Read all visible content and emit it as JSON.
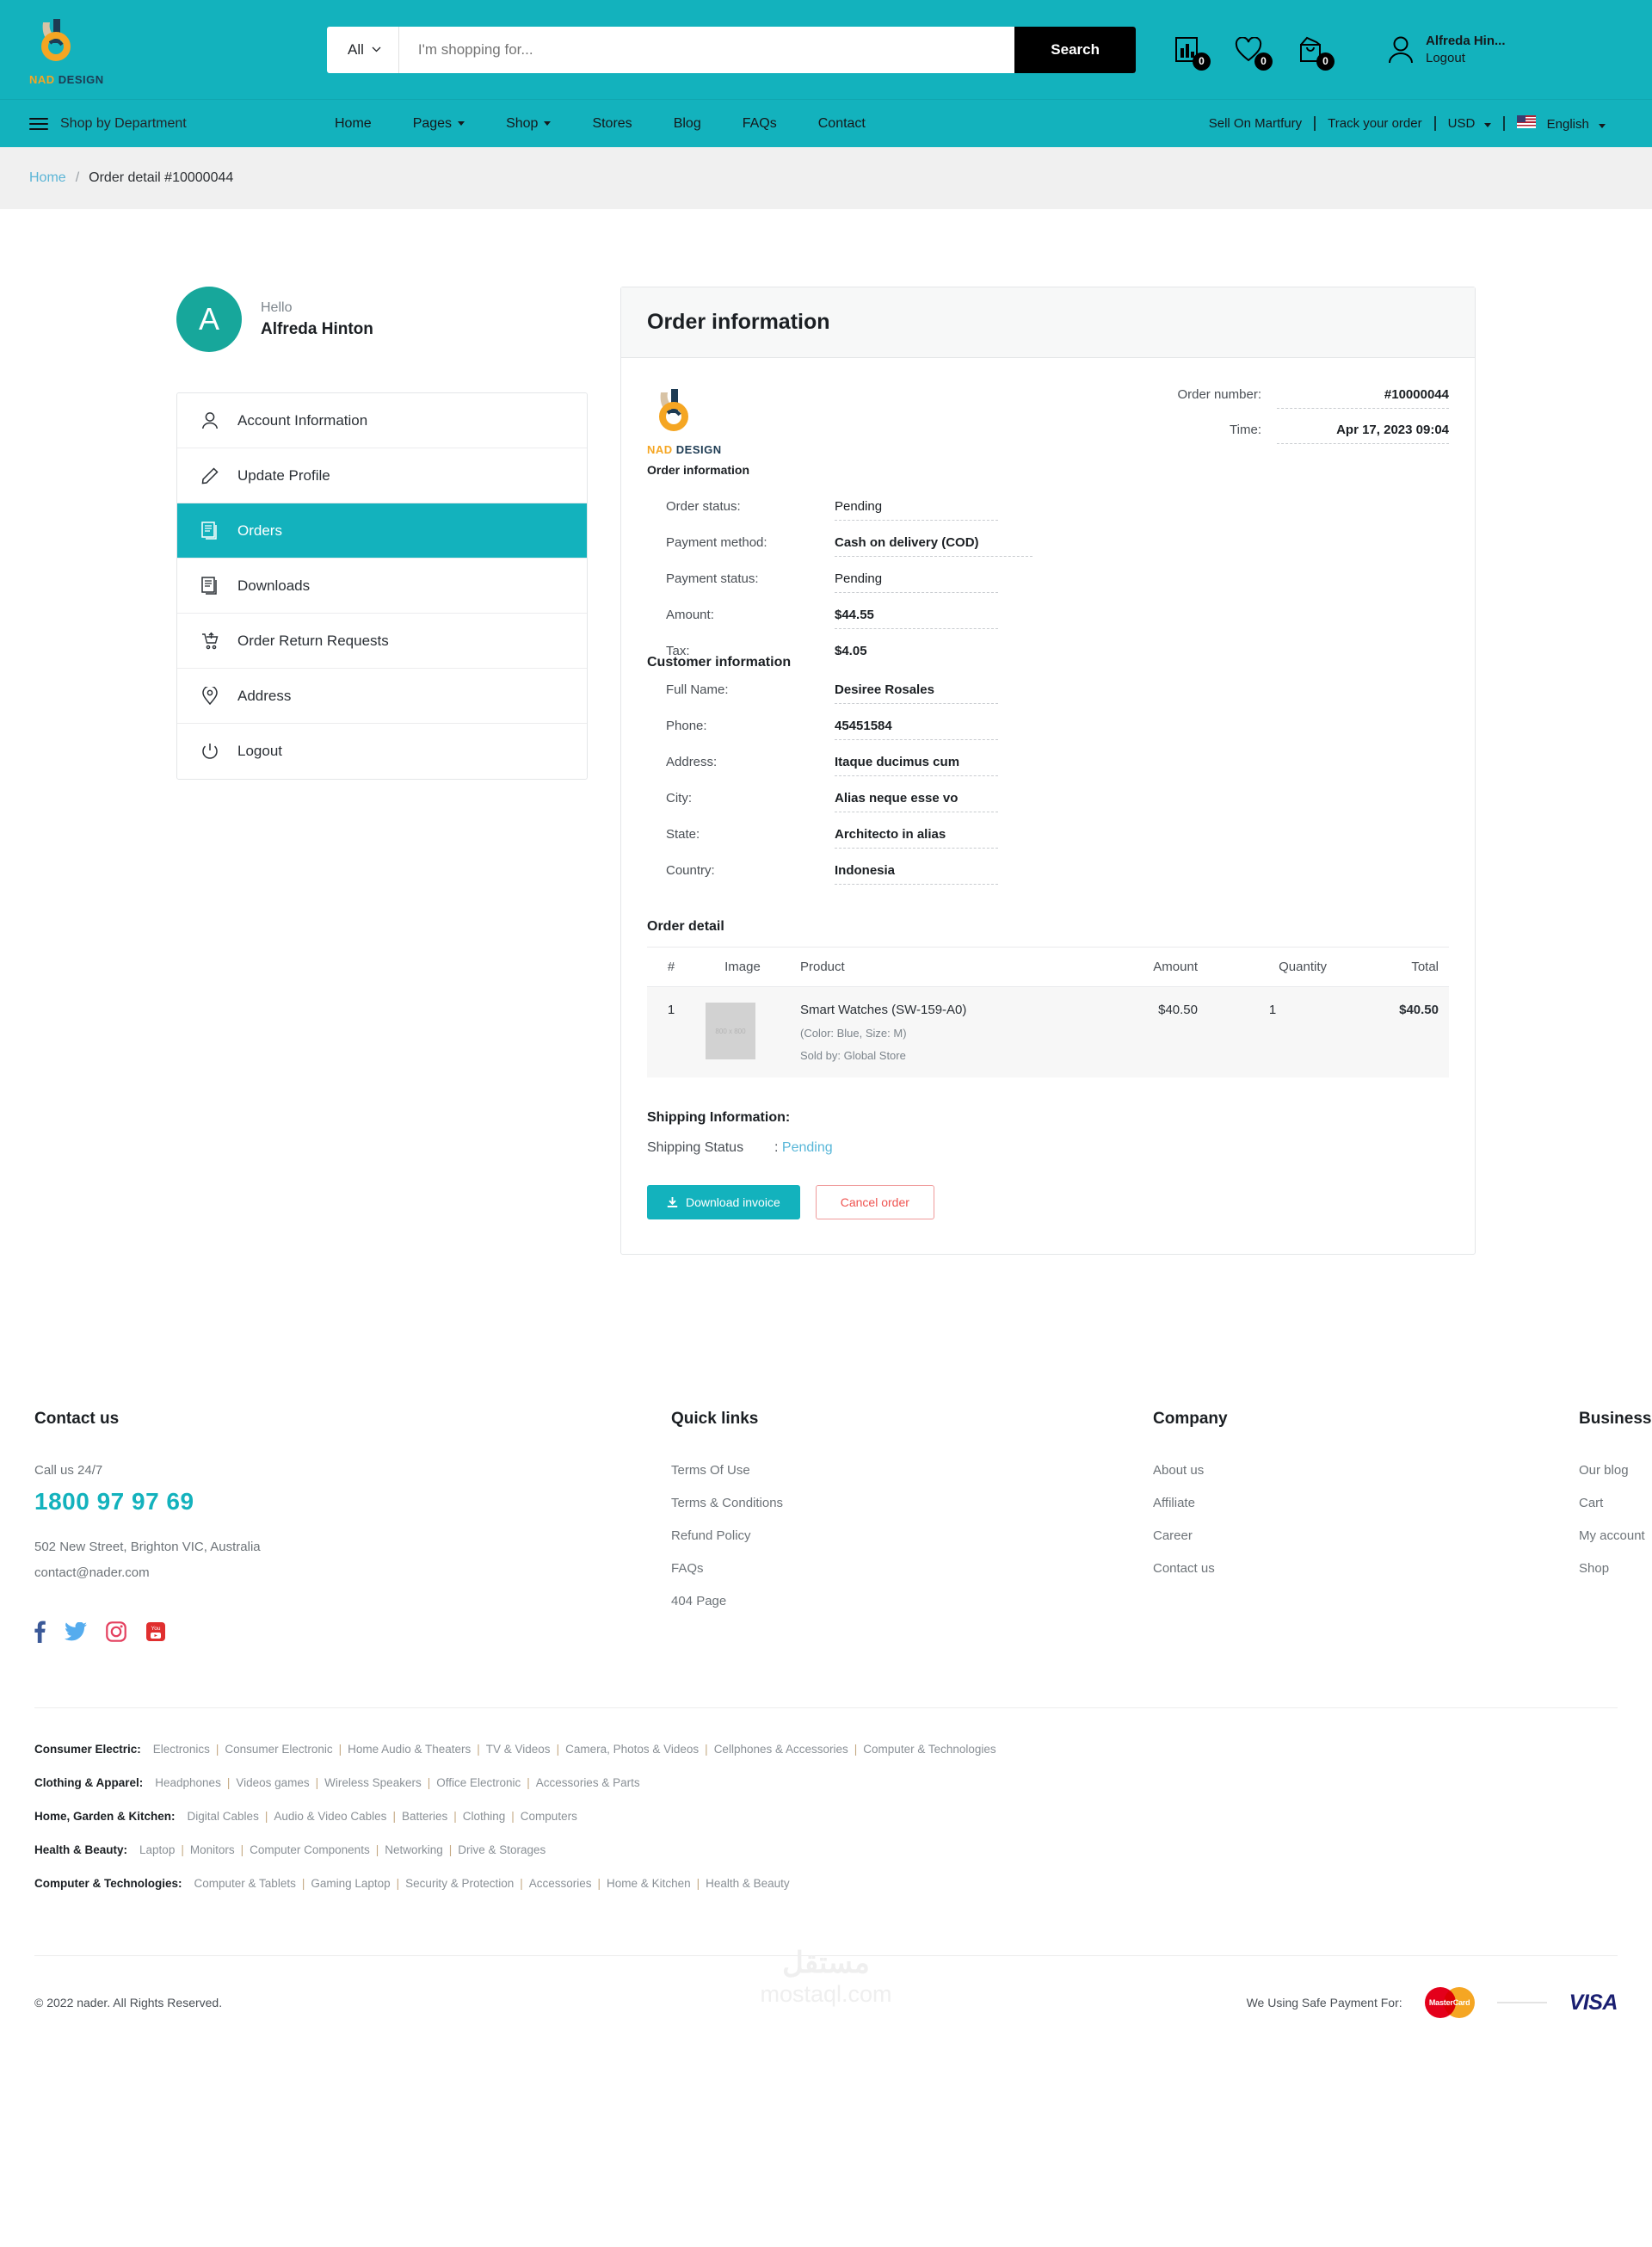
{
  "brand": {
    "logo_nad": "NAD",
    "logo_design": "DESIGN"
  },
  "header": {
    "search": {
      "category_label": "All",
      "placeholder": "I'm shopping for...",
      "button_label": "Search"
    },
    "compare_count": "0",
    "wishlist_count": "0",
    "cart_count": "0",
    "account_name": "Alfreda Hin...",
    "account_action": "Logout"
  },
  "nav": {
    "department_label": "Shop by Department",
    "links": [
      "Home",
      "Pages",
      "Shop",
      "Stores",
      "Blog",
      "FAQs",
      "Contact"
    ],
    "sell_label": "Sell On Martfury",
    "track_label": "Track your order",
    "currency": "USD",
    "language": "English"
  },
  "breadcrumb": {
    "home": "Home",
    "separator": "/",
    "current": "Order detail #10000044"
  },
  "sidebar": {
    "greeting": "Hello",
    "user_name": "Alfreda Hinton",
    "avatar_initial": "A",
    "items": [
      {
        "label": "Account Information",
        "icon": "user-icon",
        "active": false
      },
      {
        "label": "Update Profile",
        "icon": "pencil-icon",
        "active": false
      },
      {
        "label": "Orders",
        "icon": "documents-icon",
        "active": true
      },
      {
        "label": "Downloads",
        "icon": "documents-icon",
        "active": false
      },
      {
        "label": "Order Return Requests",
        "icon": "cart-return-icon",
        "active": false
      },
      {
        "label": "Address",
        "icon": "map-pin-icon",
        "active": false
      },
      {
        "label": "Logout",
        "icon": "power-icon",
        "active": false
      }
    ]
  },
  "order": {
    "card_title": "Order information",
    "invoice_caption": "Order information",
    "meta": [
      {
        "label": "Order number:",
        "value": "#10000044"
      },
      {
        "label": "Time:",
        "value": "Apr 17, 2023 09:04"
      }
    ],
    "fields": [
      {
        "label": "Order status:",
        "value": "Pending",
        "bold": false
      },
      {
        "label": "Payment method:",
        "value": "Cash on delivery (COD)",
        "bold": true
      },
      {
        "label": "Payment status:",
        "value": "Pending",
        "bold": false
      },
      {
        "label": "Amount:",
        "value": "$44.55",
        "bold": true
      },
      {
        "label": "Tax:",
        "value": "$4.05",
        "bold": true
      }
    ],
    "customer_heading": "Customer information",
    "customer": [
      {
        "label": "Full Name:",
        "value": "Desiree Rosales"
      },
      {
        "label": "Phone:",
        "value": "45451584"
      },
      {
        "label": "Address:",
        "value": "Itaque ducimus cum"
      },
      {
        "label": "City:",
        "value": "Alias neque esse vo"
      },
      {
        "label": "State:",
        "value": "Architecto in alias"
      },
      {
        "label": "Country:",
        "value": "Indonesia"
      }
    ],
    "detail_heading": "Order detail",
    "table_headers": [
      "#",
      "Image",
      "Product",
      "Amount",
      "Quantity",
      "Total"
    ],
    "items": [
      {
        "index": "1",
        "image_placeholder": "800 x 800",
        "name": "Smart Watches (SW-159-A0)",
        "variation": "(Color: Blue, Size: M)",
        "sold_by": "Sold by: Global Store",
        "amount": "$40.50",
        "quantity": "1",
        "total": "$40.50"
      }
    ],
    "shipping_heading": "Shipping Information:",
    "shipping_status_label": "Shipping Status",
    "shipping_status_value": "Pending",
    "download_invoice_label": "Download invoice",
    "cancel_order_label": "Cancel order"
  },
  "footer": {
    "contact": {
      "title": "Contact us",
      "call_label": "Call us 24/7",
      "phone": "1800 97 97 69",
      "address": "502 New Street, Brighton VIC, Australia",
      "email": "contact@nader.com"
    },
    "quick_links": {
      "title": "Quick links",
      "items": [
        "Terms Of Use",
        "Terms & Conditions",
        "Refund Policy",
        "FAQs",
        "404 Page"
      ]
    },
    "company": {
      "title": "Company",
      "items": [
        "About us",
        "Affiliate",
        "Career",
        "Contact us"
      ]
    },
    "business": {
      "title": "Business",
      "items": [
        "Our blog",
        "Cart",
        "My account",
        "Shop"
      ]
    },
    "categories": [
      {
        "label": "Consumer Electric:",
        "links": [
          "Electronics",
          "Consumer Electronic",
          "Home Audio & Theaters",
          "TV & Videos",
          "Camera, Photos & Videos",
          "Cellphones & Accessories",
          "Computer & Technologies"
        ]
      },
      {
        "label": "Clothing & Apparel:",
        "links": [
          "Headphones",
          "Videos games",
          "Wireless Speakers",
          "Office Electronic",
          "Accessories & Parts"
        ]
      },
      {
        "label": "Home, Garden & Kitchen:",
        "links": [
          "Digital Cables",
          "Audio & Video Cables",
          "Batteries",
          "Clothing",
          "Computers"
        ]
      },
      {
        "label": "Health & Beauty:",
        "links": [
          "Laptop",
          "Monitors",
          "Computer Components",
          "Networking",
          "Drive & Storages"
        ]
      },
      {
        "label": "Computer & Technologies:",
        "links": [
          "Computer & Tablets",
          "Gaming Laptop",
          "Security & Protection",
          "Accessories",
          "Home & Kitchen",
          "Health & Beauty"
        ]
      }
    ],
    "copyright": "© 2022 nader. All Rights Reserved.",
    "payment_label": "We Using Safe Payment For:",
    "mastercard_label": "MasterCard",
    "visa_label": "VISA",
    "watermark_ar": "مستقل",
    "watermark_en": "mostaql.com"
  },
  "colors": {
    "accent": "#13b2bd",
    "avatar": "#17a79b",
    "link": "#5bb5d6",
    "danger": "#ef5350"
  }
}
